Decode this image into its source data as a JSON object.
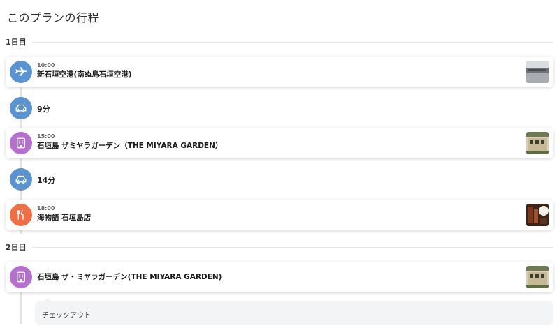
{
  "page": {
    "title": "このプランの行程"
  },
  "days": [
    {
      "label": "1日目"
    },
    {
      "label": "2日目"
    }
  ],
  "items": [
    {
      "kind": "spot",
      "icon": "airplane-icon",
      "color": "#5b93d1",
      "time": "10:00",
      "name": "新石垣空港(南ぬ島石垣空港)",
      "thumb": "airport-photo"
    },
    {
      "kind": "move",
      "icon": "car-icon",
      "color": "#5b93d1",
      "duration": "9分"
    },
    {
      "kind": "spot",
      "icon": "hotel-icon",
      "color": "#b46fcf",
      "time": "15:00",
      "name": "石垣島 ザミヤラガーデン（THE MIYARA GARDEN）",
      "thumb": "hotel-photo"
    },
    {
      "kind": "move",
      "icon": "car-icon",
      "color": "#5b93d1",
      "duration": "14分"
    },
    {
      "kind": "spot",
      "icon": "restaurant-icon",
      "color": "#ee6e45",
      "time": "18:00",
      "name": "海物語 石垣島店",
      "thumb": "restaurant-photo"
    },
    {
      "kind": "spot",
      "icon": "hotel-icon",
      "color": "#b46fcf",
      "time": "",
      "name": "石垣島 ザ・ミヤラガーデン(THE MIYARA GARDEN)",
      "thumb": "hotel-photo"
    }
  ],
  "note": {
    "text": "チェックアウト"
  }
}
